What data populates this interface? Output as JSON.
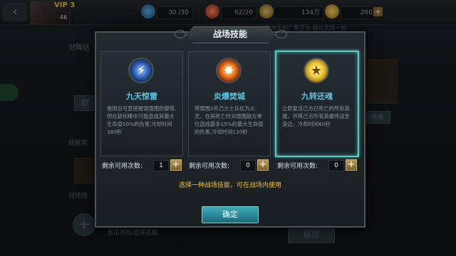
{
  "topbar": {
    "vip": "VIP 3",
    "level": "46",
    "stamina": "30 /30",
    "energy": "62/20",
    "gold": "134万",
    "gems": "260",
    "ticker": "神州大地广寒玉功 强化玄铁一阶"
  },
  "background": {
    "section1": "对阵信",
    "section2": "获胜奖",
    "section3": "战场技",
    "btn_left": "欧",
    "btn_right": "挑战",
    "tag_right": "装备",
    "select_hint": "点击图标选择技能"
  },
  "dialog": {
    "title": "战场技能",
    "count_label": "剩余可用次数:",
    "hint": "选择一种战场技能，可在战场内使用",
    "ok_label": "确定",
    "skills": [
      {
        "icon": "thunder-icon",
        "name": "九天惊雷",
        "desc": "使用后可直接摧毁周围防御塔,但在敌何棒中只能造成其最大生命值50%的伤害,冷却时间180秒",
        "count": "1",
        "selected": false
      },
      {
        "icon": "explosion-icon",
        "name": "炎爆焚城",
        "desc": "将周围3名己方士兵化为火灵，在其死亡时对周围敌方单位造成最多15%的最大生命值的伤害,冷却时间120秒",
        "count": "0",
        "selected": false
      },
      {
        "icon": "revive-icon",
        "name": "九转还魂",
        "desc": "立即复活己方已死亡的所有英雄，并将己方所有英雄传送至身边，冷却时间60秒",
        "count": "0",
        "selected": true
      }
    ]
  },
  "colors": {
    "accent": "#5fc6c4",
    "skill_name": "#57c7e8",
    "hint": "#f1c232"
  }
}
